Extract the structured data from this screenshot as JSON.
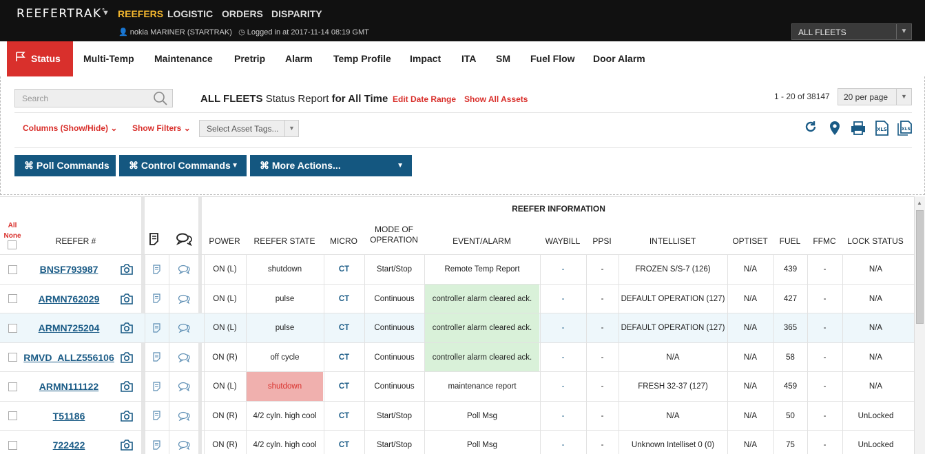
{
  "topbar": {
    "brand": "REEFERTRAK",
    "brand_mark": "°",
    "nav": [
      "REEFERS",
      "LOGISTIC",
      "ORDERS",
      "DISPARITY"
    ],
    "user": "nokia MARINER (STARTRAK)",
    "login": "Logged in at 2017-11-14 08:19 GMT",
    "fleet_select": "ALL FLEETS"
  },
  "tabs": [
    "Status",
    "Multi-Temp",
    "Maintenance",
    "Pretrip",
    "Alarm",
    "Temp Profile",
    "Impact",
    "ITA",
    "SM",
    "Fuel Flow",
    "Door Alarm"
  ],
  "toolbar": {
    "search_placeholder": "Search",
    "report_scope": "ALL FLEETS",
    "report_name": "Status Report",
    "report_period": "for All Time",
    "edit_date_range": "Edit Date Range",
    "show_all_assets": "Show All Assets",
    "pager": "1 - 20 of 38147",
    "per_page": "20 per page",
    "columns_toggle": "Columns (Show/Hide)",
    "show_filters": "Show Filters",
    "asset_tags_placeholder": "Select Asset Tags...",
    "poll_commands": "⌘ Poll Commands",
    "control_commands": "⌘ Control Commands",
    "more_actions": "⌘ More Actions..."
  },
  "colors": {
    "accent_red": "#d9302c",
    "nav_blue": "#145780",
    "link_blue": "#1a5b86",
    "active_nav": "#f5b82e"
  },
  "grid": {
    "all": "All",
    "none": "None",
    "group_header": "REEFER INFORMATION",
    "columns": [
      "REEFER #",
      "POWER",
      "REEFER STATE",
      "MICRO",
      "MODE OF OPERATION",
      "EVENT/ALARM",
      "WAYBILL",
      "PPSI",
      "INTELLISET",
      "OPTISET",
      "FUEL",
      "FFMC",
      "LOCK STATUS"
    ],
    "rows": [
      {
        "reefer": "BNSF793987",
        "power": "ON (L)",
        "state": "shutdown",
        "micro": "CT",
        "mode": "Start/Stop",
        "event": "Remote Temp Report",
        "waybill": "-",
        "ppsi": "-",
        "intelliset": "FROZEN S/S-7 (126)",
        "optiset": "N/A",
        "fuel": "439",
        "ffmc": "-",
        "lock": "N/A"
      },
      {
        "reefer": "ARMN762029",
        "power": "ON (L)",
        "state": "pulse",
        "micro": "CT",
        "mode": "Continuous",
        "event": "controller alarm cleared ack.",
        "waybill": "-",
        "ppsi": "-",
        "intelliset": "DEFAULT OPERATION (127)",
        "optiset": "N/A",
        "fuel": "427",
        "ffmc": "-",
        "lock": "N/A"
      },
      {
        "reefer": "ARMN725204",
        "power": "ON (L)",
        "state": "pulse",
        "micro": "CT",
        "mode": "Continuous",
        "event": "controller alarm cleared ack.",
        "waybill": "-",
        "ppsi": "-",
        "intelliset": "DEFAULT OPERATION (127)",
        "optiset": "N/A",
        "fuel": "365",
        "ffmc": "-",
        "lock": "N/A"
      },
      {
        "reefer": "RMVD_ALLZ556106",
        "power": "ON (R)",
        "state": "off cycle",
        "micro": "CT",
        "mode": "Continuous",
        "event": "controller alarm cleared ack.",
        "waybill": "-",
        "ppsi": "-",
        "intelliset": "N/A",
        "optiset": "N/A",
        "fuel": "58",
        "ffmc": "-",
        "lock": "N/A"
      },
      {
        "reefer": "ARMN111122",
        "power": "ON (L)",
        "state": "shutdown",
        "micro": "CT",
        "mode": "Continuous",
        "event": "maintenance report",
        "waybill": "-",
        "ppsi": "-",
        "intelliset": "FRESH 32-37 (127)",
        "optiset": "N/A",
        "fuel": "459",
        "ffmc": "-",
        "lock": "N/A"
      },
      {
        "reefer": "T51186",
        "power": "ON (R)",
        "state": "4/2 cyln. high cool",
        "micro": "CT",
        "mode": "Start/Stop",
        "event": "Poll Msg",
        "waybill": "-",
        "ppsi": "-",
        "intelliset": "N/A",
        "optiset": "N/A",
        "fuel": "50",
        "ffmc": "-",
        "lock": "UnLocked"
      },
      {
        "reefer": "722422",
        "power": "ON (R)",
        "state": "4/2 cyln. high cool",
        "micro": "CT",
        "mode": "Start/Stop",
        "event": "Poll Msg",
        "waybill": "-",
        "ppsi": "-",
        "intelliset": "Unknown Intelliset 0 (0)",
        "optiset": "N/A",
        "fuel": "75",
        "ffmc": "-",
        "lock": "UnLocked"
      }
    ]
  }
}
